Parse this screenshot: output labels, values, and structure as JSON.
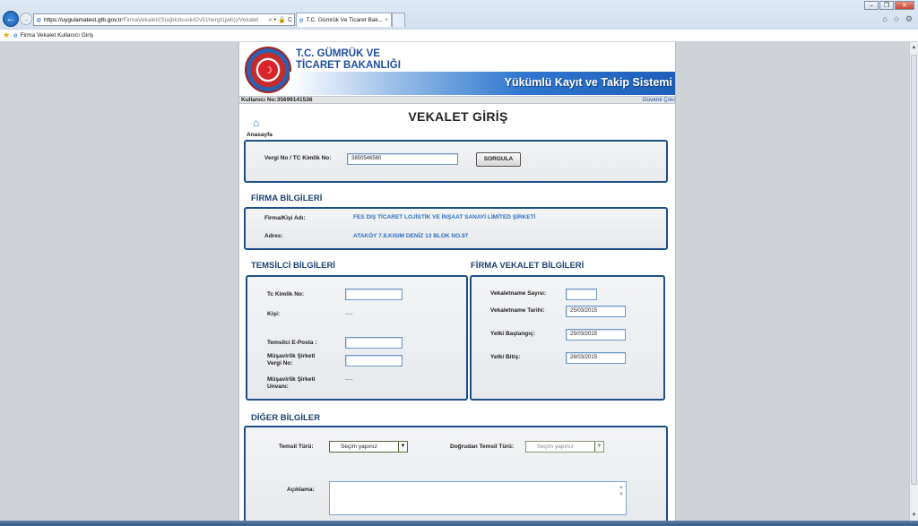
{
  "browser": {
    "url_host": "https://uygulamatest.gtb.gov.tr",
    "url_path": "/FirmaVekalet/(S(ejbkzkuok42v51hergt1jwb))/Vekalet",
    "url_controls": "⌕ ▾ 🔒 C",
    "tab_title": "T.C. Gümrük Ve Ticaret Bak...",
    "tab_close": "×",
    "favorite_link": "Firma Vekalet Kullanıcı Giriş",
    "win_minimize": "–",
    "win_restore": "❐",
    "win_close": "✕",
    "tool_home": "⌂",
    "tool_fav": "☆",
    "tool_settings": "⚙"
  },
  "header": {
    "ministry_line1": "T.C. GÜMRÜK VE",
    "ministry_line2": "TİCARET BAKANLIĞI",
    "system_title": "Yükümlü Kayıt ve Takip Sistemi"
  },
  "userbar": {
    "user_label": "Kullanıcı No:35699141536",
    "logout_label": "Güvenli Çıkış"
  },
  "page": {
    "title": "VEKALET GİRİŞ",
    "home_label": "Anasayfa"
  },
  "query": {
    "label": "Vergi No / TC Kimlik No:",
    "value": "3850546560",
    "button_label": "SORGULA"
  },
  "firma": {
    "section_title": "FİRMA BİLGİLERİ",
    "name_label": "Firma/Kişi Adı:",
    "name_value": "FES DIŞ TİCARET LOJİSTİK VE İNŞAAT SANAYİ LİMİTED ŞİRKETİ",
    "address_label": "Adres:",
    "address_value": "ATAKÖY 7.8.KISIM DENİZ 13 BLOK NO.97"
  },
  "temsilci": {
    "section_title": "TEMSİLCİ BİLGİLERİ",
    "tc_label": "Tc Kimlik No:",
    "tc_value": "",
    "kisi_label": "Kişi:",
    "kisi_value": "----",
    "email_label": "Temsilci E-Posta :",
    "email_value": "",
    "musavirlik_vergi_label_1": "Müşavirlik Şirketi",
    "musavirlik_vergi_label_2": "Vergi No:",
    "musavirlik_vergi_value": "",
    "musavirlik_unvan_label_1": "Müşavirlik Şirketi",
    "musavirlik_unvan_label_2": "Unvanı:",
    "musavirlik_unvan_value": "----"
  },
  "vekalet": {
    "section_title": "FİRMA VEKALET BİLGİLERİ",
    "sayisi_label": "Vekaletname Sayısı:",
    "sayisi_value": "",
    "tarihi_label": "Vekaletname Tarihi:",
    "tarihi_value": "25/03/2015",
    "baslangic_label": "Yetki Başlangıç:",
    "baslangic_value": "25/03/2015",
    "bitis_label": "Yetki Bitiş:",
    "bitis_value": "26/03/2015"
  },
  "diger": {
    "section_title": "DİĞER BİLGİLER",
    "temsil_turu_label": "Temsil Türü:",
    "temsil_turu_value": "Seçim yapınız",
    "dogrudan_label": "Doğrudan Temsil Türü:",
    "dogrudan_value": "Seçim yapınız",
    "aciklama_label": "Açıklama:",
    "aciklama_value": ""
  },
  "colors": {
    "panel_border": "#1f4f87",
    "link_blue": "#2f6fc0",
    "section_heading": "#1e4370",
    "banner_blue": "#1d5fb8"
  },
  "icons": [
    "back-arrow-icon",
    "forward-arrow-icon",
    "ie-icon",
    "star-icon",
    "home-icon",
    "gear-icon",
    "ministry-logo-icon",
    "chevron-down-icon"
  ]
}
